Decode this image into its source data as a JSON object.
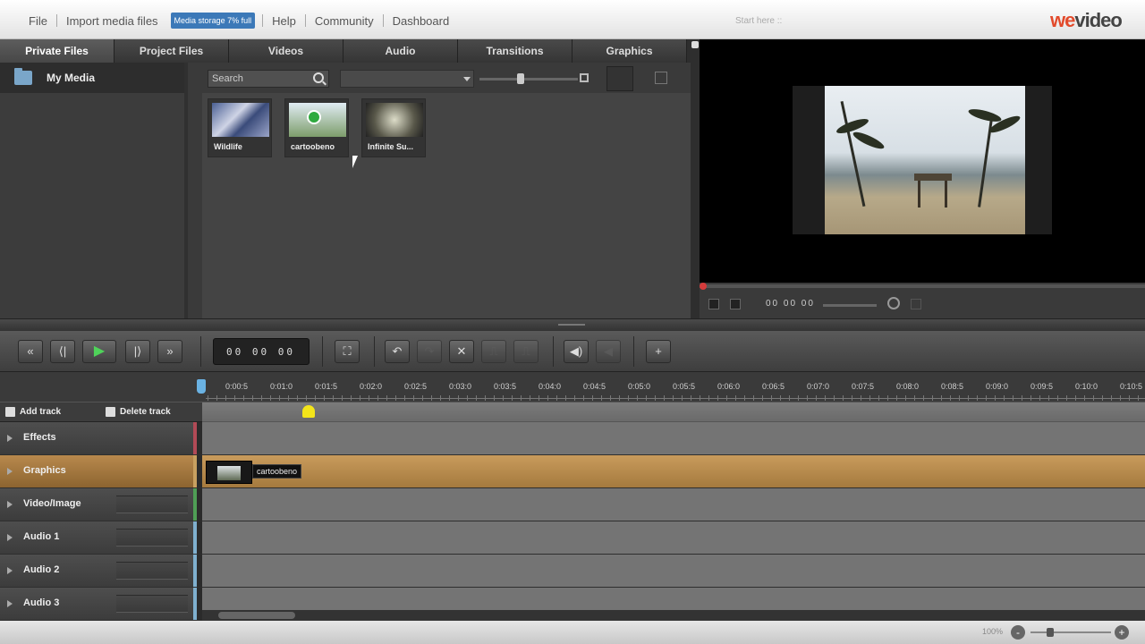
{
  "menu": {
    "file": "File",
    "import": "Import media files",
    "storage": "Media storage 7% full",
    "help": "Help",
    "community": "Community",
    "dashboard": "Dashboard",
    "start_here": "Start here ::",
    "logo_a": "we",
    "logo_b": "video"
  },
  "library": {
    "tabs": [
      "Private Files",
      "Project Files",
      "Videos",
      "Audio",
      "Transitions",
      "Graphics"
    ],
    "sidebar_item": "My Media",
    "search_placeholder": "Search",
    "thumbnails": [
      {
        "label": "Wildlife"
      },
      {
        "label": "cartoobeno"
      },
      {
        "label": "Infinite Su..."
      }
    ]
  },
  "preview": {
    "timecode": "00 00 00"
  },
  "transport": {
    "rewind": "«",
    "prev_frame": "⟨|",
    "play": "▶",
    "next_frame": "|⟩",
    "fast_forward": "»",
    "timecode": "00 00 00",
    "fit": "⛶",
    "undo": "↶",
    "redo": "↷",
    "delete": "✕",
    "split": "⎍",
    "merge": "⎍",
    "volume": "◀)",
    "mute": "◀",
    "add": "+"
  },
  "ruler": {
    "ticks": [
      "0:00:5",
      "0:01:0",
      "0:01:5",
      "0:02:0",
      "0:02:5",
      "0:03:0",
      "0:03:5",
      "0:04:0",
      "0:04:5",
      "0:05:0",
      "0:05:5",
      "0:06:0",
      "0:06:5",
      "0:07:0",
      "0:07:5",
      "0:08:0",
      "0:08:5",
      "0:09:0",
      "0:09:5",
      "0:10:0",
      "0:10:5"
    ]
  },
  "timeline": {
    "add_track": "Add track",
    "delete_track": "Delete track",
    "tracks": [
      {
        "name": "Effects",
        "stripe": "#b24a56"
      },
      {
        "name": "Graphics",
        "stripe": "#c8a060"
      },
      {
        "name": "Video/Image",
        "stripe": "#4f9e55"
      },
      {
        "name": "Audio 1",
        "stripe": "#7fb0cf"
      },
      {
        "name": "Audio 2",
        "stripe": "#7fb0cf"
      },
      {
        "name": "Audio 3",
        "stripe": "#7fb0cf"
      }
    ],
    "clip_label": "cartoobeno"
  },
  "status": {
    "zoom_label": "100%",
    "zoom_out": "-",
    "zoom_in": "+"
  }
}
